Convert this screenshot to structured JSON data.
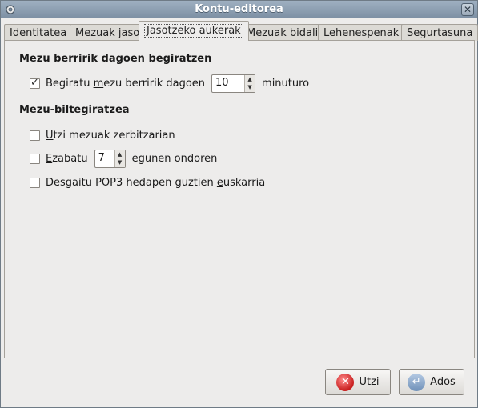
{
  "window": {
    "title": "Kontu-editorea",
    "close_glyph": "✕",
    "app_icon": "gear-icon"
  },
  "tabs": [
    {
      "label": "Identitatea",
      "active": false
    },
    {
      "label": "Mezuak jaso",
      "active": false
    },
    {
      "label": "Jasotzeko aukerak",
      "active": true
    },
    {
      "label": "Mezuak bidali",
      "active": false
    },
    {
      "label": "Lehenespenak",
      "active": false
    },
    {
      "label": "Segurtasuna",
      "active": false
    }
  ],
  "check_section": {
    "title": "Mezu berririk dagoen begiratzen",
    "check_label_pre": "Begiratu ",
    "check_label_u": "m",
    "check_label_post": "ezu berririk dagoen",
    "checked": true,
    "interval_value": "10",
    "unit_label": "minuturo"
  },
  "storage_section": {
    "title": "Mezu-biltegiratzea",
    "leave_u": "U",
    "leave_rest": "tzi mezuak zerbitzarian",
    "leave_checked": false,
    "delete_u": "E",
    "delete_rest": "zabatu",
    "delete_checked": false,
    "delete_days_value": "7",
    "delete_suffix": "egunen ondoren",
    "disable_pre": "Desgaitu POP3 hedapen guztien ",
    "disable_u": "e",
    "disable_post": "uskarria",
    "disable_checked": false
  },
  "buttons": {
    "cancel_u": "U",
    "cancel_rest": "tzi",
    "ok_label": "Ados"
  },
  "colors": {
    "titlebar": "#8a9cb0",
    "window_bg": "#edeceb",
    "cancel_icon": "#c81e1e",
    "ok_icon": "#6f90b8"
  }
}
